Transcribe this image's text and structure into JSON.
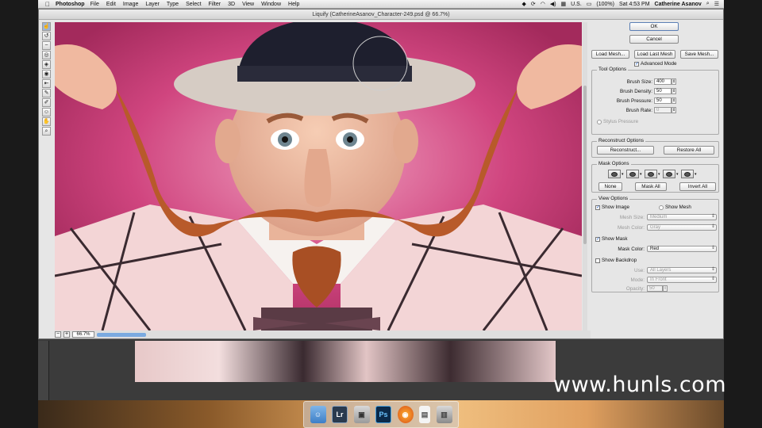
{
  "menubar": {
    "app": "Photoshop",
    "items": [
      "File",
      "Edit",
      "Image",
      "Layer",
      "Type",
      "Select",
      "Filter",
      "3D",
      "View",
      "Window",
      "Help"
    ],
    "battery": "(100%)",
    "input_source": "U.S.",
    "clock": "Sat 4:53 PM",
    "user": "Catherine Asanov"
  },
  "dialog": {
    "title": "Liquify (CatherineAsanov_Character-249.psd @ 66.7%)",
    "zoom": "66.7%"
  },
  "panel": {
    "ok": "OK",
    "cancel": "Cancel",
    "load_mesh": "Load Mesh...",
    "load_last_mesh": "Load Last Mesh",
    "save_mesh": "Save Mesh...",
    "advanced_mode": "Advanced Mode",
    "tool_options": {
      "title": "Tool Options",
      "brush_size_label": "Brush Size:",
      "brush_size": "400",
      "brush_density_label": "Brush Density:",
      "brush_density": "50",
      "brush_pressure_label": "Brush Pressure:",
      "brush_pressure": "50",
      "brush_rate_label": "Brush Rate:",
      "brush_rate": "0",
      "stylus_pressure": "Stylus Pressure"
    },
    "reconstruct": {
      "title": "Reconstruct Options",
      "reconstruct_button": "Reconstruct...",
      "restore_all": "Restore All"
    },
    "mask": {
      "title": "Mask Options",
      "none": "None",
      "mask_all": "Mask All",
      "invert_all": "Invert All"
    },
    "view": {
      "title": "View Options",
      "show_image": "Show Image",
      "show_mesh": "Show Mesh",
      "mesh_size_label": "Mesh Size:",
      "mesh_size": "Medium",
      "mesh_color_label": "Mesh Color:",
      "mesh_color": "Gray",
      "show_mask": "Show Mask",
      "mask_color_label": "Mask Color:",
      "mask_color": "Red",
      "show_backdrop": "Show Backdrop",
      "use_label": "Use:",
      "use": "All Layers",
      "mode_label": "Mode:",
      "mode": "In Front",
      "opacity_label": "Opacity:",
      "opacity": "50"
    }
  },
  "watermark": "www.hunls.com",
  "dock": [
    "Finder",
    "Lr",
    "Preview",
    "Ps",
    "Firefox",
    "Document",
    "Trash"
  ]
}
